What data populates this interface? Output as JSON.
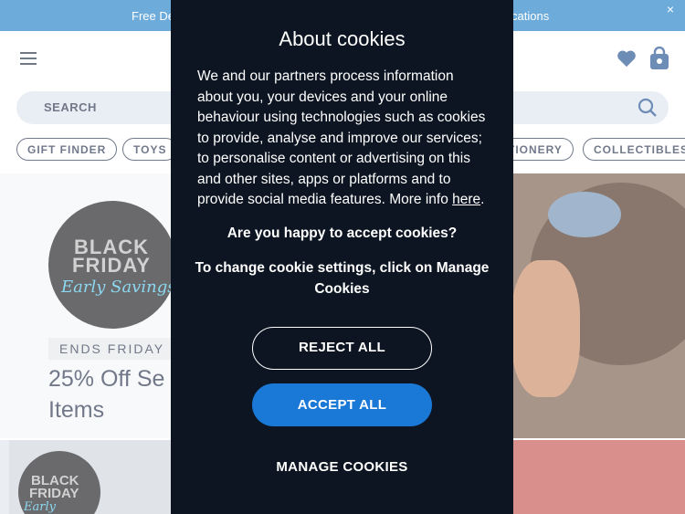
{
  "banner": {
    "text_left": "Free De",
    "text_right": "cations",
    "close_label": "×"
  },
  "header": {
    "search_placeholder": "SEARCH"
  },
  "pills": [
    {
      "label": "GIFT FINDER"
    },
    {
      "label": "TOYS"
    },
    {
      "label": "TIONERY"
    },
    {
      "label": "COLLECTIBLES"
    }
  ],
  "hero": {
    "badge_line1": "BLACK",
    "badge_line2": "FRIDAY",
    "badge_line3": "Early Savings",
    "ends": "ENDS FRIDAY .",
    "promo": "25% Off Se Items"
  },
  "lower": {
    "badge_line1": "BLACK",
    "badge_line2": "FRIDAY",
    "badge_line3": "Early Savings"
  },
  "cookie_modal": {
    "title": "About cookies",
    "body": "We and our partners process information about you, your devices and your online behaviour using technologies such as cookies to provide, analyse and improve our services; to personalise content or advertising on this and other sites, apps or platforms and to provide social media features. More info ",
    "link_text": "here",
    "body_end": ".",
    "question": "Are you happy to accept cookies?",
    "instruction": "To change cookie settings, click on Manage Cookies",
    "reject_label": "REJECT ALL",
    "accept_label": "ACCEPT ALL",
    "manage_label": "MANAGE COOKIES"
  },
  "colors": {
    "banner": "#1f7ec6",
    "modal_bg": "#0c1521",
    "accept_button": "#1a78d6",
    "navy_text": "#25314a"
  }
}
